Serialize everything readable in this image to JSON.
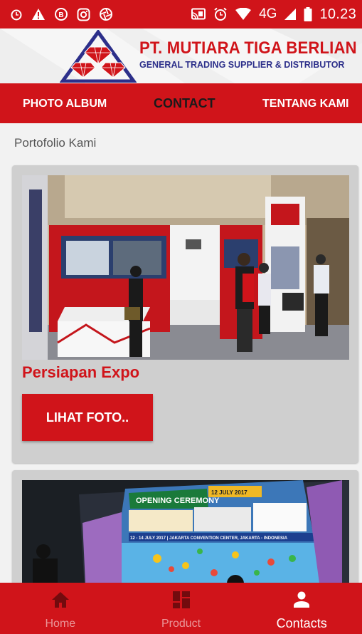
{
  "status_bar": {
    "network": "4G",
    "time": "10.23",
    "icons": [
      "alarm-icon",
      "warning-icon",
      "bbm-icon",
      "instagram-icon",
      "shutter-icon",
      "cast-icon",
      "alarm-clock-icon",
      "wifi-icon",
      "signal-icon",
      "battery-icon"
    ]
  },
  "header": {
    "company_name": "PT. MUTIARA TIGA BERLIAN",
    "tagline": "GENERAL TRADING SUPPLIER & DISTRIBUTOR"
  },
  "nav": {
    "items": [
      {
        "label": "PHOTO ALBUM"
      },
      {
        "label": "CONTACT"
      },
      {
        "label": "TENTANG KAMI"
      }
    ]
  },
  "main": {
    "section_title": "Portofolio Kami",
    "cards": [
      {
        "title": "Persiapan Expo",
        "button_label": "LIHAT FOTO.."
      },
      {
        "title": "",
        "button_label": ""
      }
    ],
    "photo_texts": {
      "banner": "OPENING CEREMONY",
      "date": "12 JULY 2017",
      "venue": "12 - 14 JULY 2017 | JAKARTA CONVENTION CENTER, JAKARTA - INDONESIA"
    }
  },
  "bottom_nav": {
    "items": [
      {
        "label": "Home",
        "active": false
      },
      {
        "label": "Product",
        "active": false
      },
      {
        "label": "Contacts",
        "active": true
      }
    ]
  },
  "colors": {
    "brand_red": "#d0141a",
    "brand_blue": "#2c2f8a",
    "card_bg": "#cfcfcf"
  }
}
